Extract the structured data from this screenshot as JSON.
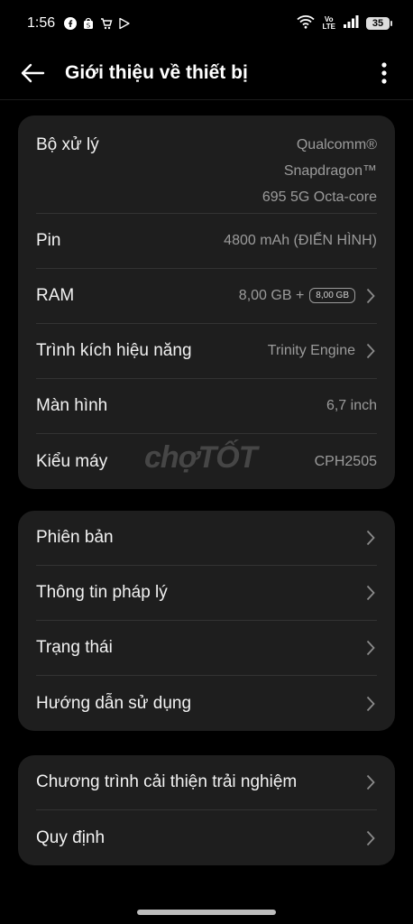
{
  "status_bar": {
    "time": "1:56",
    "notification_icons": [
      "facebook-icon",
      "shop-icon",
      "tiki-icon",
      "play-store-icon"
    ],
    "volte_line1": "Vo",
    "volte_line2": "LTE",
    "battery": "35"
  },
  "header": {
    "title": "Giới thiệu về thiết bị"
  },
  "specs": {
    "cpu_label": "Bộ xử lý",
    "cpu_value_line1": "Qualcomm®",
    "cpu_value_line2": "Snapdragon™",
    "cpu_value_line3": "695 5G Octa-core",
    "battery_label": "Pin",
    "battery_value": "4800 mAh (ĐIỂN HÌNH)",
    "ram_label": "RAM",
    "ram_value": "8,00 GB +",
    "ram_extra": "8,00 GB",
    "performance_label": "Trình kích hiệu năng",
    "performance_value": "Trinity Engine",
    "screen_label": "Màn hình",
    "screen_value": "6,7 inch",
    "model_label": "Kiểu máy",
    "model_value": "CPH2505"
  },
  "watermark": "chợTỐT",
  "menu1": {
    "version": "Phiên bản",
    "legal": "Thông tin pháp lý",
    "status": "Trạng thái",
    "guide": "Hướng dẫn sử dụng"
  },
  "menu2": {
    "experience": "Chương trình cải thiện trải nghiệm",
    "regulations": "Quy định"
  },
  "colors": {
    "background": "#000000",
    "card": "#1e1e1e",
    "secondary_text": "#9b9b9b"
  }
}
